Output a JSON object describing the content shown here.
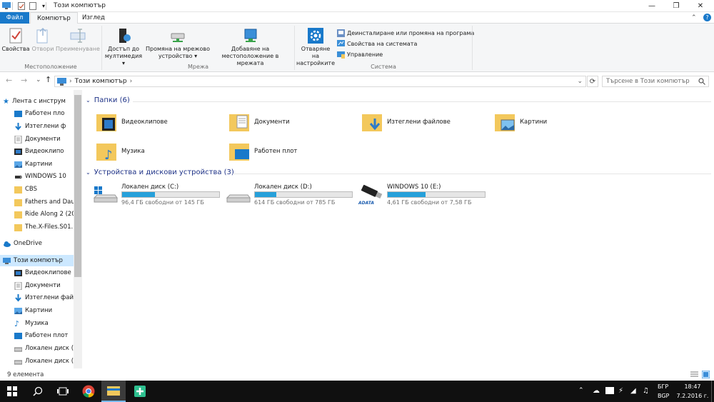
{
  "window": {
    "title": "Този компютър",
    "minimize": "—",
    "restore": "❐",
    "close": "✕",
    "help": "?",
    "chevron": "⌃"
  },
  "tabs": {
    "file": "Файл",
    "computer": "Компютър",
    "view": "Изглед"
  },
  "ribbon": {
    "location": {
      "label": "Местоположение",
      "buttons": [
        "Свойства",
        "Отвори",
        "Преименуване"
      ]
    },
    "network": {
      "label": "Мрежа",
      "buttons": [
        {
          "line1": "Достъп до",
          "line2": "мултимедия ▾"
        },
        {
          "line1": "Промяна на мрежово",
          "line2": "устройство ▾"
        },
        {
          "line1": "Добавяне на",
          "line2": "местоположение в мрежата"
        }
      ]
    },
    "system": {
      "label": "Система",
      "settings": {
        "line1": "Отваряне на",
        "line2": "настройките"
      },
      "small": [
        "Деинсталиране или промяна на програма",
        "Свойства на системата",
        "Управление"
      ]
    }
  },
  "address": {
    "back": "←",
    "forward": "→",
    "dropdown": "⌄",
    "up": "↑",
    "path": "Този компютър",
    "sep": "›",
    "refresh": "⟳",
    "search_placeholder": "Търсене в Този компютър"
  },
  "nav": {
    "quick": "Лента с инструм",
    "items": [
      "Работен пло",
      "Изтеглени ф",
      "Документи",
      "Видеоклипо",
      "Картини",
      "WINDOWS 10",
      "CBS",
      "Fathers and Dau",
      "Ride Along 2 (20",
      "The.X-Files.S01.1"
    ],
    "onedrive": "OneDrive",
    "thispc": "Този компютър",
    "pcitems": [
      "Видеоклипове",
      "Документи",
      "Изтеглени файл",
      "Картини",
      "Музика",
      "Работен плот",
      "Локален диск (C",
      "Локален диск (D"
    ]
  },
  "folders": {
    "header": "Папки (6)",
    "items": [
      "Видеоклипове",
      "Документи",
      "Изтеглени файлове",
      "Картини",
      "Музика",
      "Работен плот"
    ]
  },
  "drives": {
    "header": "Устройства и дискови устройства (3)",
    "items": [
      {
        "name": "Локален диск (C:)",
        "free": "96,4 ГБ свободни от 145 ГБ",
        "used": 0.34
      },
      {
        "name": "Локален диск (D:)",
        "free": "614 ГБ свободни от 785 ГБ",
        "used": 0.22
      },
      {
        "name": "WINDOWS 10 (E:)",
        "free": "4,61 ГБ свободни от 7,58 ГБ",
        "used": 0.39
      }
    ],
    "adata": "ADATA"
  },
  "status": {
    "count": "9 елемента"
  },
  "taskbar": {
    "time": "18:47",
    "date": "7.2.2016 г.",
    "lang1": "БГР",
    "lang2": "BGP"
  },
  "colors": {
    "accent": "#1979ca",
    "folder": "#f3c85c",
    "bar": "#26a0da",
    "taskbar": "#101010"
  }
}
